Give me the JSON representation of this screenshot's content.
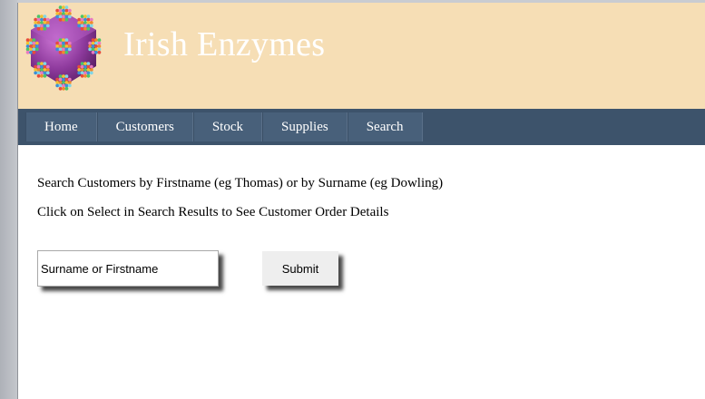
{
  "header": {
    "title": "Irish Enzymes",
    "logo_icon": "enzyme-molecule-icon"
  },
  "nav": {
    "items": [
      {
        "label": "Home"
      },
      {
        "label": "Customers"
      },
      {
        "label": "Stock"
      },
      {
        "label": "Supplies"
      },
      {
        "label": "Search"
      }
    ]
  },
  "main": {
    "instruction_1": "Search Customers by Firstname (eg Thomas) or by Surname (eg Dowling)",
    "instruction_2": "Click on Select in Search Results to See Customer Order Details",
    "search": {
      "value": "",
      "placeholder": "Surname or Firstname"
    },
    "submit_label": "Submit"
  },
  "colors": {
    "header_bg": "#f6deb5",
    "nav_bg": "#3d536b",
    "nav_item_bg": "#48607a",
    "title_text": "#ffffff"
  }
}
